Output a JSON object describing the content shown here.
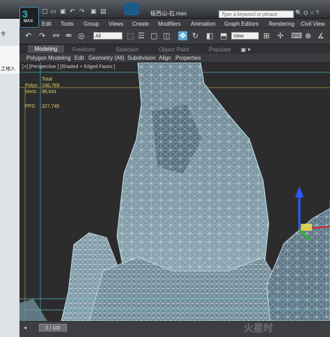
{
  "app": {
    "logo_text": "MAX",
    "window_title": "极西山-石.max",
    "search_placeholder": "Type a keyword or phrase",
    "quick_access": [
      "↶",
      "↷",
      "▣"
    ]
  },
  "menu": [
    "Edit",
    "Tools",
    "Group",
    "Views",
    "Create",
    "Modifiers",
    "Animation",
    "Graph Editors",
    "Rendering",
    "Civil View"
  ],
  "toolbar": {
    "selection_filter": "All",
    "ref_coord": "View"
  },
  "ribbon": {
    "tabs": [
      "Modeling",
      "Freeform",
      "Selection",
      "Object Paint",
      "Populate"
    ],
    "active_tab": "Modeling",
    "panels": [
      "Polygon Modeling",
      "Edit",
      "Geometry (All)",
      "Subdivision",
      "Align",
      "Properties"
    ]
  },
  "left_strip": {
    "items": [
      "令",
      "之地入"
    ]
  },
  "viewport": {
    "label": "[+] [Perspective ] [Shaded + Edged Faces ]",
    "stats": {
      "header": "Total",
      "polys_label": "Polys:",
      "polys": "140,769",
      "verts_label": "Verts:",
      "verts": "96,641",
      "fps_label": "FPS:",
      "fps": "327.745"
    }
  },
  "timeline": {
    "frame": "0 / 100"
  },
  "watermark": "火星时"
}
